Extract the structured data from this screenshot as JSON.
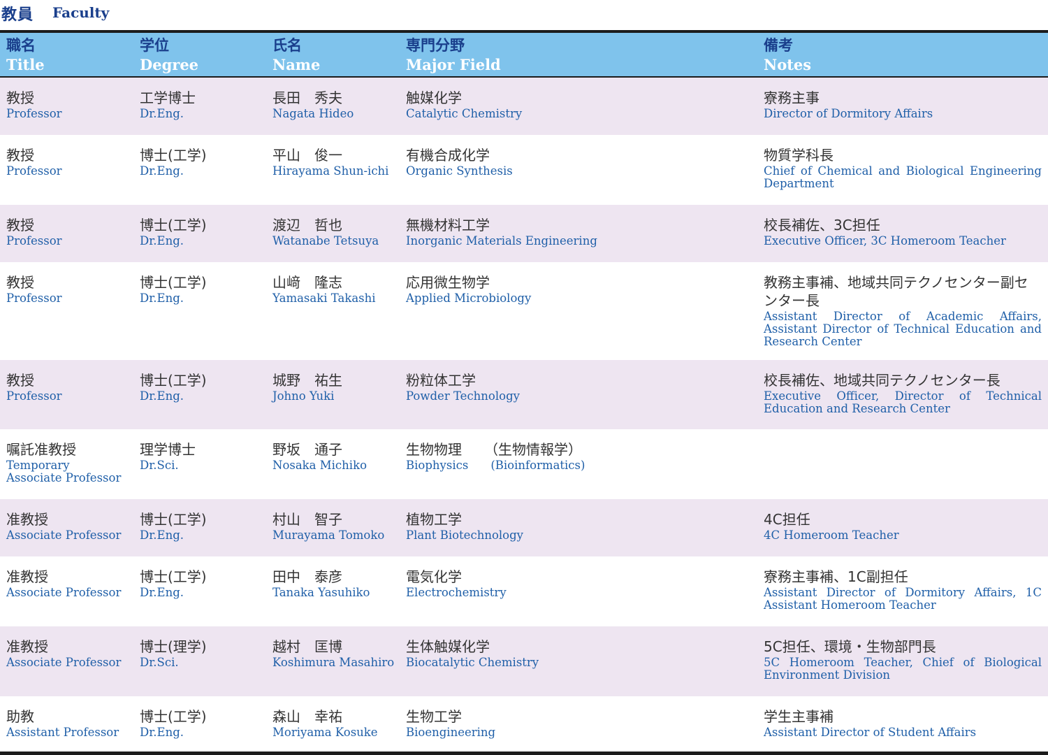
{
  "heading": {
    "ja": "教員",
    "en": "Faculty"
  },
  "columns": [
    {
      "ja": "職名",
      "en": "Title"
    },
    {
      "ja": "学位",
      "en": "Degree"
    },
    {
      "ja": "氏名",
      "en": "Name"
    },
    {
      "ja": "専門分野",
      "en": "Major Field"
    },
    {
      "ja": "備考",
      "en": "Notes"
    }
  ],
  "rows": [
    {
      "title_ja": "教授",
      "title_en": "Professor",
      "degree_ja": "工学博士",
      "degree_en": "Dr.Eng.",
      "name_ja": "長田　秀夫",
      "name_en": "Nagata Hideo",
      "field_ja": "触媒化学",
      "field_en": "Catalytic Chemistry",
      "notes_ja": "寮務主事",
      "notes_en": "Director of Dormitory Affairs"
    },
    {
      "title_ja": "教授",
      "title_en": "Professor",
      "degree_ja": "博士(工学)",
      "degree_en": "Dr.Eng.",
      "name_ja": "平山　俊一",
      "name_en": "Hirayama Shun-ichi",
      "field_ja": "有機合成化学",
      "field_en": "Organic Synthesis",
      "notes_ja": "物質学科長",
      "notes_en": "Chief of Chemical and Biological Engineering Department"
    },
    {
      "title_ja": "教授",
      "title_en": "Professor",
      "degree_ja": "博士(工学)",
      "degree_en": "Dr.Eng.",
      "name_ja": "渡辺　哲也",
      "name_en": "Watanabe Tetsuya",
      "field_ja": "無機材料工学",
      "field_en": "Inorganic Materials Engineering",
      "notes_ja": "校長補佐、3C担任",
      "notes_en": "Executive Officer, 3C Homeroom Teacher"
    },
    {
      "title_ja": "教授",
      "title_en": "Professor",
      "degree_ja": "博士(工学)",
      "degree_en": "Dr.Eng.",
      "name_ja": "山﨑　隆志",
      "name_en": "Yamasaki Takashi",
      "field_ja": "応用微生物学",
      "field_en": "Applied Microbiology",
      "notes_ja": "教務主事補、地域共同テクノセンター副センター長",
      "notes_en": "Assistant Director of Academic Affairs, Assistant Director of Technical Education and Research Center"
    },
    {
      "title_ja": "教授",
      "title_en": "Professor",
      "degree_ja": "博士(工学)",
      "degree_en": "Dr.Eng.",
      "name_ja": "城野　祐生",
      "name_en": "Johno Yuki",
      "field_ja": "粉粒体工学",
      "field_en": "Powder Technology",
      "notes_ja": "校長補佐、地域共同テクノセンター長",
      "notes_en": "Executive Officer, Director of Technical Education and Research Center"
    },
    {
      "title_ja": "嘱託准教授",
      "title_en": "Temporary Associate Professor",
      "degree_ja": "理学博士",
      "degree_en": "Dr.Sci.",
      "name_ja": "野坂　通子",
      "name_en": "Nosaka Michiko",
      "field_ja": "生物物理",
      "field_ja2": "（生物情報学）",
      "field_en": "Biophysics",
      "field_en2": "(Bioinformatics)",
      "notes_ja": "",
      "notes_en": ""
    },
    {
      "title_ja": "准教授",
      "title_en": "Associate Professor",
      "degree_ja": "博士(工学)",
      "degree_en": "Dr.Eng.",
      "name_ja": "村山　智子",
      "name_en": "Murayama Tomoko",
      "field_ja": "植物工学",
      "field_en": "Plant Biotechnology",
      "notes_ja": "4C担任",
      "notes_en": "4C Homeroom Teacher"
    },
    {
      "title_ja": "准教授",
      "title_en": "Associate Professor",
      "degree_ja": "博士(工学)",
      "degree_en": "Dr.Eng.",
      "name_ja": "田中　泰彦",
      "name_en": "Tanaka Yasuhiko",
      "field_ja": "電気化学",
      "field_en": "Electrochemistry",
      "notes_ja": "寮務主事補、1C副担任",
      "notes_en": "Assistant Director of Dormitory Affairs, 1C Assistant Homeroom Teacher"
    },
    {
      "title_ja": "准教授",
      "title_en": "Associate Professor",
      "degree_ja": "博士(理学)",
      "degree_en": "Dr.Sci.",
      "name_ja": "越村　匡博",
      "name_en": "Koshimura Masahiro",
      "field_ja": "生体触媒化学",
      "field_en": "Biocatalytic Chemistry",
      "notes_ja": "5C担任、環境・生物部門長",
      "notes_en": "5C Homeroom Teacher, Chief of Biological Environment Division"
    },
    {
      "title_ja": "助教",
      "title_en": "Assistant Professor",
      "degree_ja": "博士(工学)",
      "degree_en": "Dr.Eng.",
      "name_ja": "森山　幸祐",
      "name_en": "Moriyama Kosuke",
      "field_ja": "生物工学",
      "field_en": "Bioengineering",
      "notes_ja": "学生主事補",
      "notes_en": "Assistant Director of Student Affairs"
    }
  ]
}
